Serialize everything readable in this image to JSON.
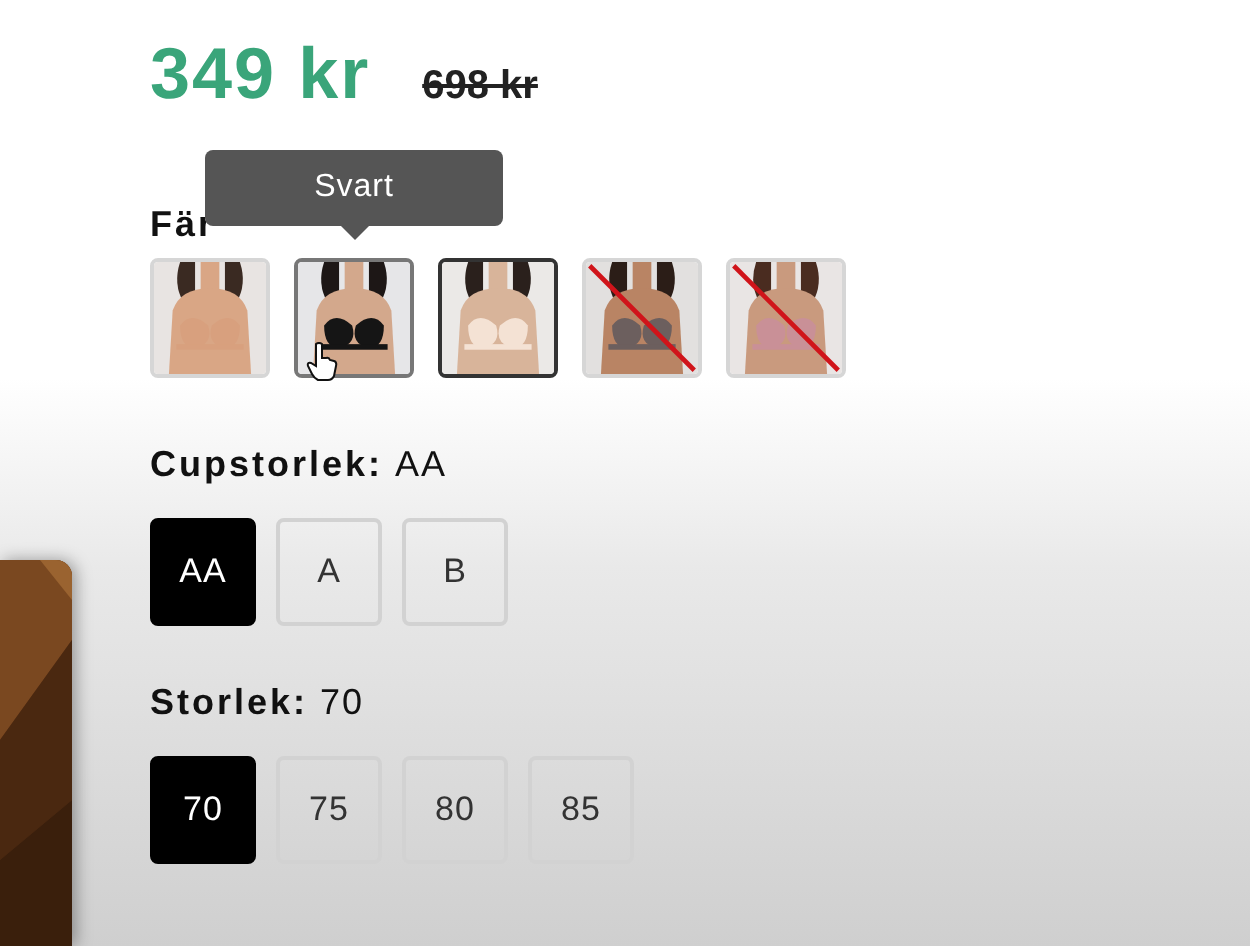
{
  "price": {
    "current": "349 kr",
    "original": "698 kr"
  },
  "color_label": "Fär",
  "swatches": [
    {
      "kind": "picture",
      "selected": false,
      "hovered": false,
      "available": true
    },
    {
      "kind": "picture",
      "selected": false,
      "hovered": true,
      "available": true,
      "tooltip": "Svart"
    },
    {
      "kind": "picture",
      "selected": true,
      "hovered": false,
      "available": true
    },
    {
      "kind": "picture",
      "selected": false,
      "hovered": false,
      "available": false
    },
    {
      "kind": "picture",
      "selected": false,
      "hovered": false,
      "available": false
    }
  ],
  "size_groups": [
    {
      "label": "Cupstorlek:",
      "value": "AA",
      "options": [
        {
          "label": "AA",
          "selected": true
        },
        {
          "label": "A",
          "selected": false
        },
        {
          "label": "B",
          "selected": false
        }
      ]
    },
    {
      "label": "Storlek:",
      "value": "70",
      "options": [
        {
          "label": "70",
          "selected": true
        },
        {
          "label": "75",
          "selected": false
        },
        {
          "label": "80",
          "selected": false
        },
        {
          "label": "85",
          "selected": false
        }
      ]
    }
  ],
  "side_card": {
    "kind": "picture"
  }
}
